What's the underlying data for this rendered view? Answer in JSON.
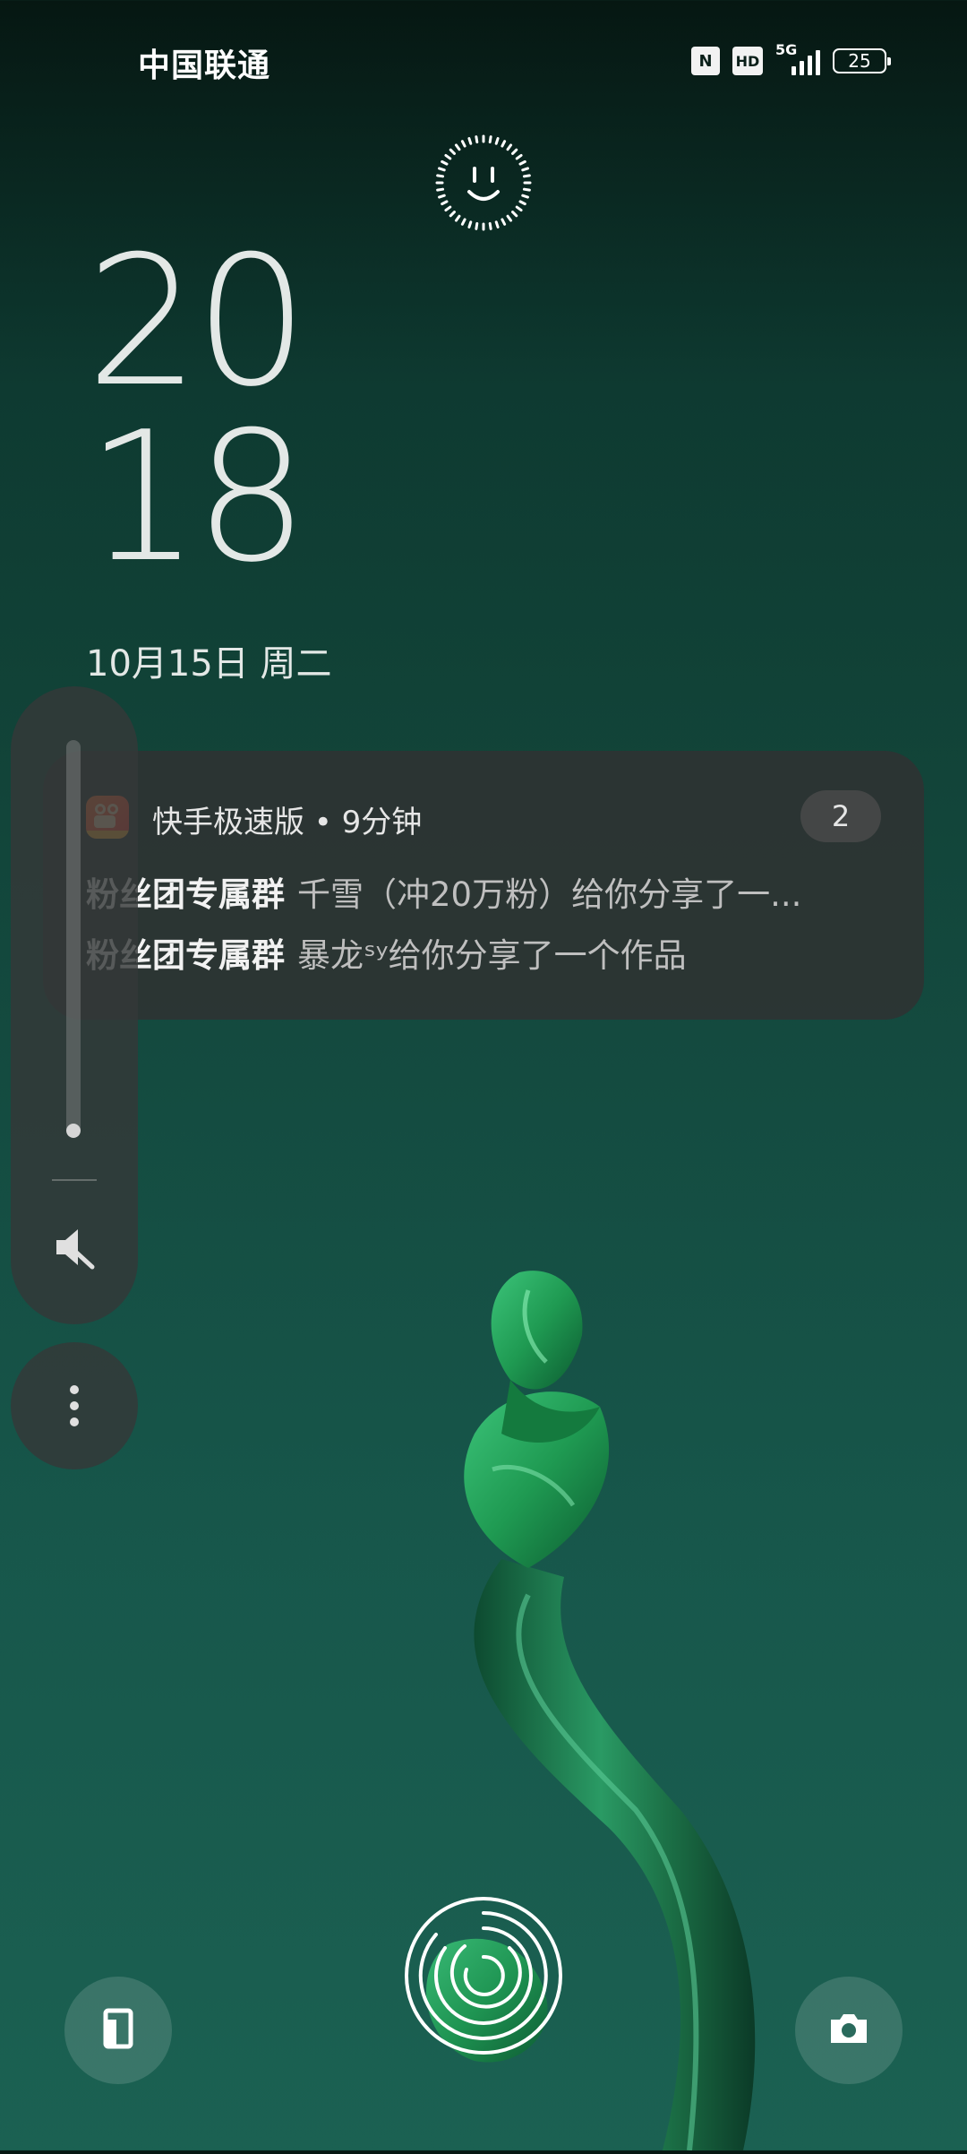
{
  "status_bar": {
    "carrier": "中国联通",
    "nfc_label": "N",
    "hd_label": "HD",
    "network_type": "5G",
    "signal_icon": "signal-bars-icon",
    "battery_level": "25"
  },
  "lock_screen": {
    "face_unlock_icon": "face-unlock-icon",
    "clock": {
      "hours": "20",
      "minutes": "18"
    },
    "date": "10月15日 周二"
  },
  "notification": {
    "app_icon": "kuaishou-lite-icon",
    "header": "快手极速版 • 9分钟",
    "count": "2",
    "messages": [
      {
        "group": "粉丝团专属群",
        "text": "千雪（冲20万粉）给你分享了一..."
      },
      {
        "group": "粉丝团专属群",
        "text": "暴龙ˢʸ给你分享了一个作品"
      }
    ]
  },
  "volume": {
    "level_fraction": 0.03,
    "mute_icon": "speaker-mute-icon",
    "more_icon": "more-vertical-icon"
  },
  "bottom": {
    "left_icon": "wallet-icon",
    "center_icon": "fingerprint-icon",
    "right_icon": "camera-icon"
  },
  "colors": {
    "background_top": "#061712",
    "background_bottom": "#1b6152",
    "plant_green": "#1f9a52",
    "notification_bg": "#303232"
  }
}
